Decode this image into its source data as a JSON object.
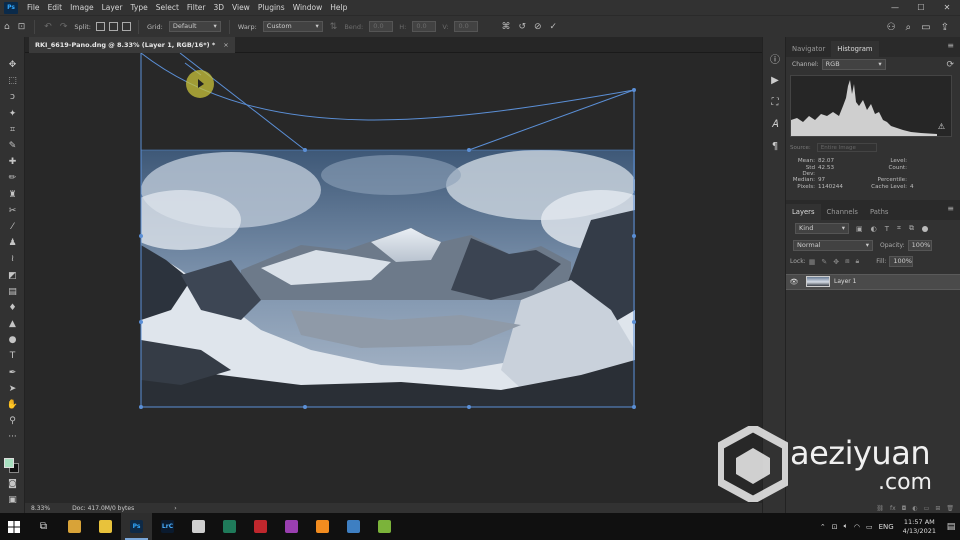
{
  "app": {
    "logo": "Ps"
  },
  "menu": [
    "File",
    "Edit",
    "Image",
    "Layer",
    "Type",
    "Select",
    "Filter",
    "3D",
    "View",
    "Plugins",
    "Window",
    "Help"
  ],
  "window_controls": [
    "—",
    "☐",
    "✕"
  ],
  "options": {
    "split_label": "Split:",
    "grid_label": "Grid:",
    "grid_value": "Default",
    "warp_label": "Warp:",
    "warp_value": "Custom",
    "bend_label": "Bend:",
    "bend_value": "0.0",
    "h_label": "H:",
    "h_value": "0.0",
    "v_label": "V:",
    "v_value": "0.0"
  },
  "doc_tab": {
    "title": "RKI_6619-Pano.dng @ 8.33% (Layer 1, RGB/16*) *",
    "close": "×"
  },
  "status": {
    "zoom": "8.33%",
    "doc": "Doc: 417.0M/0 bytes",
    "arrow": "›"
  },
  "panels": {
    "top_tabs": [
      "Navigator",
      "Histogram"
    ],
    "channel_label": "Channel:",
    "channel_value": "RGB",
    "source_label": "Source:",
    "source_value": "Entire Image",
    "stats": [
      {
        "k": "Mean:",
        "v": "82.07",
        "k2": "Level:",
        "v2": ""
      },
      {
        "k": "Std Dev:",
        "v": "42.53",
        "k2": "Count:",
        "v2": ""
      },
      {
        "k": "Median:",
        "v": "97",
        "k2": "Percentile:",
        "v2": ""
      },
      {
        "k": "Pixels:",
        "v": "1140244",
        "k2": "Cache Level:",
        "v2": "4"
      }
    ],
    "layer_tabs": [
      "Layers",
      "Channels",
      "Paths"
    ],
    "kind_value": "Kind",
    "blend_mode": "Normal",
    "opacity_label": "Opacity:",
    "opacity_value": "100%",
    "lock_label": "Lock:",
    "fill_label": "Fill:",
    "fill_value": "100%",
    "layer_name": "Layer 1"
  },
  "watermark": {
    "text": "aeziyuan",
    "suffix": ".com"
  },
  "taskbar": {
    "apps": [
      {
        "label": "",
        "color": "#d8a338"
      },
      {
        "label": "",
        "color": "#e8c23b"
      },
      {
        "label": "Ps",
        "color": "#0e2a47"
      },
      {
        "label": "LrC",
        "color": "#0a1a2e"
      },
      {
        "label": "",
        "color": "#cfcfcf"
      },
      {
        "label": "",
        "color": "#1f7a5a"
      },
      {
        "label": "",
        "color": "#c0272d"
      },
      {
        "label": "",
        "color": "#9a3fb0"
      },
      {
        "label": "",
        "color": "#f28c1f"
      },
      {
        "label": "",
        "color": "#3e7fc2"
      },
      {
        "label": "",
        "color": "#7bb33a"
      }
    ],
    "lang": "ENG",
    "time": "11:57 AM",
    "date": "4/13/2021"
  }
}
